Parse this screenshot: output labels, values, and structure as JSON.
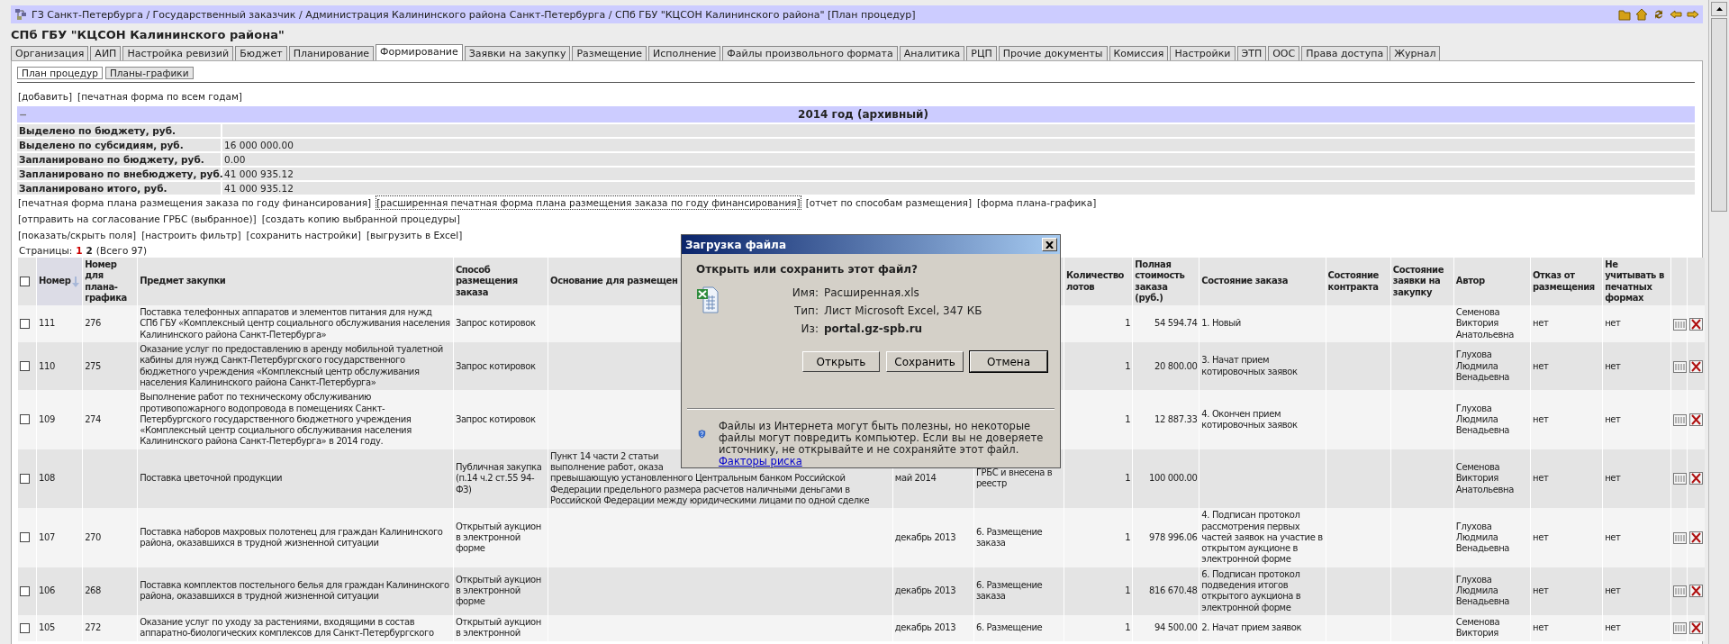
{
  "breadcrumbs": "ГЗ Санкт-Петербурга / Государственный заказчик / Администрация Калининского района Санкт-Петербурга / СПб ГБУ \"КЦСОН Калининского района\" [План процедур]",
  "org_title": "СПб ГБУ \"КЦСОН Калининского района\"",
  "tabs": [
    {
      "label": "Организация",
      "selected": false
    },
    {
      "label": "АИП",
      "selected": false
    },
    {
      "label": "Настройка ревизий",
      "selected": false
    },
    {
      "label": "Бюджет",
      "selected": false
    },
    {
      "label": "Планирование",
      "selected": false
    },
    {
      "label": "Формирование",
      "selected": true
    },
    {
      "label": "Заявки на закупку",
      "selected": false
    },
    {
      "label": "Размещение",
      "selected": false
    },
    {
      "label": "Исполнение",
      "selected": false
    },
    {
      "label": "Файлы произвольного формата",
      "selected": false
    },
    {
      "label": "Аналитика",
      "selected": false
    },
    {
      "label": "РЦП",
      "selected": false
    },
    {
      "label": "Прочие документы",
      "selected": false
    },
    {
      "label": "Комиссия",
      "selected": false
    },
    {
      "label": "Настройки",
      "selected": false
    },
    {
      "label": "ЭТП",
      "selected": false
    },
    {
      "label": "ООС",
      "selected": false
    },
    {
      "label": "Права доступа",
      "selected": false
    },
    {
      "label": "Журнал",
      "selected": false
    }
  ],
  "subtabs": [
    {
      "label": "План процедур",
      "selected": true
    },
    {
      "label": "Планы-графики",
      "selected": false
    }
  ],
  "top_links": [
    "[добавить]",
    "[печатная форма по всем годам]"
  ],
  "year_section": {
    "collapse": "−",
    "title": "2014 год (архивный)",
    "summary": [
      {
        "label": "Выделено по бюджету, руб."
      },
      {
        "label": "Выделено по субсидиям, руб.",
        "value": "16 000 000.00"
      },
      {
        "label": "Запланировано по бюджету, руб.",
        "value": "0.00"
      },
      {
        "label": "Запланировано по внебюджету, руб.",
        "value": "41 000 935.12"
      },
      {
        "label": "Запланировано итого, руб.",
        "value": "41 000 935.12"
      }
    ]
  },
  "action_links": [
    [
      {
        "text": "[печатная форма плана размещения заказа по году финансирования]",
        "focused": false
      },
      {
        "text": "[расширенная печатная форма плана размещения заказа по году финансирования]",
        "focused": true
      },
      {
        "text": "[отчет по способам размещения]",
        "focused": false
      },
      {
        "text": "[форма плана-графика]",
        "focused": false
      }
    ],
    [
      {
        "text": "[отправить на согласование ГРБС (выбранное)]",
        "focused": false
      },
      {
        "text": "[создать копию выбранной процедуры]",
        "focused": false
      }
    ],
    [
      {
        "text": "[показать/скрыть поля]",
        "focused": false
      },
      {
        "text": "[настроить фильтр]",
        "focused": false
      },
      {
        "text": "[сохранить настройки]",
        "focused": false
      },
      {
        "text": "[выгрузить в Excel]",
        "focused": false
      }
    ]
  ],
  "pager": {
    "label": "Страницы:",
    "pages": [
      {
        "label": "1",
        "selected": true
      },
      {
        "label": "2",
        "selected": false
      }
    ],
    "total": "(Всего 97)"
  },
  "table": {
    "select_all": {
      "checked": false
    },
    "columns": [
      {
        "title": "Номер",
        "sorted": true
      },
      {
        "title": "Номер для плана-графика",
        "sorted": false
      },
      {
        "title": "Предмет закупки",
        "sorted": false
      },
      {
        "title": "Способ размещения заказа",
        "sorted": false
      },
      {
        "title": "Основание для размещен",
        "sorted": false
      },
      {
        "title": "Количество лотов",
        "sorted": false
      },
      {
        "title": "Полная стоимость заказа (руб.)",
        "sorted": false
      },
      {
        "title": "Состояние заказа",
        "sorted": false
      },
      {
        "title": "Состояние контракта",
        "sorted": false
      },
      {
        "title": "Состояние заявки на закупку",
        "sorted": false
      },
      {
        "title": "Автор",
        "sorted": false
      },
      {
        "title": "Отказ от размещения",
        "sorted": false
      },
      {
        "title": "Не учитывать в печатных формах",
        "sorted": false
      }
    ],
    "rows": [
      {
        "checked": false,
        "number": "111",
        "plan_number": "276",
        "subject": "Поставка телефонных аппаратов и элементов питания для нужд СПб ГБУ «Комплексный центр социального обслуживания населения Калининского района Санкт-Петербурга»",
        "method": "Запрос котировок",
        "lots": "1",
        "cost": "54 594.74",
        "order_state": "1. Новый",
        "author": "Семенова Виктория Анатольевна",
        "refusal": "нет",
        "exclude": "нет"
      },
      {
        "checked": false,
        "number": "110",
        "plan_number": "275",
        "subject": "Оказание услуг по предоставлению в аренду мобильной туалетной кабины для нужд Санкт-Петербургского государственного бюджетного учреждения «Комплексный центр обслуживания населения Калининского района Санкт-Петербурга»",
        "method": "Запрос котировок",
        "lots": "1",
        "cost": "20 800.00",
        "order_state": "3. Начат прием котировочных заявок",
        "author": "Глухова Людмила Венадьевна",
        "refusal": "нет",
        "exclude": "нет"
      },
      {
        "checked": false,
        "number": "109",
        "plan_number": "274",
        "subject": "Выполнение работ по техническому обслуживанию противопожарного водопровода в помещениях Санкт-Петербургского государственного бюджетного учреждения «Комплексный центр социального обслуживания населения Калининского района Санкт-Петербурга» в 2014 году.",
        "method": "Запрос котировок",
        "lots": "1",
        "cost": "12 887.33",
        "order_state": "4. Окончен прием котировочных заявок",
        "author": "Глухова Людмила Венадьевна",
        "refusal": "нет",
        "exclude": "нет"
      },
      {
        "checked": false,
        "number": "108",
        "subject": "Поставка цветочной продукции",
        "method": "Публичная закупка (п.14 ч.2 ст.55 94-ФЗ)",
        "basis_lines": [
          "Пункт 14 части 2 статьи",
          "выполнение работ, оказа",
          "превышающую установленного Центральным банком Российской",
          "Федерации предельного размера расчетов наличными деньгами в",
          "Российской Федерации между юридическими лицами по одной сделке"
        ],
        "date": "май 2014",
        "status": "ГРБС и внесена в\nреестр",
        "lots": "1",
        "cost": "100 000.00",
        "author": "Семенова Виктория Анатольевна",
        "refusal": "нет",
        "exclude": "нет"
      },
      {
        "checked": false,
        "number": "107",
        "plan_number": "270",
        "subject": "Поставка наборов махровых полотенец для граждан Калининского района, оказавшихся в трудной жизненной ситуации",
        "method": "Открытый аукцион в электронной форме",
        "date": "декабрь 2013",
        "status": "6. Размещение заказа",
        "lots": "1",
        "cost": "978 996.06",
        "order_state": "4. Подписан протокол рассмотрения первых частей заявок на участие в открытом аукционе в электронной форме",
        "author": "Глухова Людмила Венадьевна",
        "refusal": "нет",
        "exclude": "нет"
      },
      {
        "checked": false,
        "number": "106",
        "plan_number": "268",
        "subject": "Поставка комплектов постельного белья для граждан Калининского района, оказавшихся в трудной жизненной ситуации",
        "method": "Открытый аукцион в электронной форме",
        "date": "декабрь 2013",
        "status": "6. Размещение заказа",
        "lots": "1",
        "cost": "816 670.48",
        "order_state": "6. Подписан протокол подведения итогов открытого аукциона в электронной форме",
        "author": "Глухова Людмила Венадьевна",
        "refusal": "нет",
        "exclude": "нет"
      },
      {
        "checked": false,
        "number": "105",
        "plan_number": "272",
        "subject": "Оказание услуг по уходу за растениями, входящими в состав аппаратно-биологических комплексов для Санкт-Петербургского",
        "method": "Открытый аукцион в электронной",
        "date": "декабрь 2013",
        "status": "6. Размещение",
        "lots": "1",
        "cost": "94 500.00",
        "order_state": "2. Начат прием заявок",
        "author": "Семенова Виктория",
        "refusal": "нет",
        "exclude": "нет"
      }
    ]
  },
  "dialog": {
    "title": "Загрузка файла",
    "heading": "Открыть или сохранить этот файл?",
    "fields": [
      {
        "label": "Имя:",
        "value": "Расширенная.xls",
        "emphasis": false
      },
      {
        "label": "Тип:",
        "value": "Лист Microsoft Excel, 347 КБ",
        "emphasis": false
      },
      {
        "label": "Из:",
        "value": "portal.gz-spb.ru",
        "emphasis": true
      }
    ],
    "buttons": [
      {
        "label": "Открыть",
        "default": false
      },
      {
        "label": "Сохранить",
        "default": false
      },
      {
        "label": "Отмена",
        "default": true
      }
    ],
    "warning": "Файлы из Интернета могут быть полезны, но некоторые файлы могут повредить компьютер. Если вы не доверяете источнику, не открывайте и не сохраняйте этот файл.",
    "risk_link": "Факторы риска"
  }
}
